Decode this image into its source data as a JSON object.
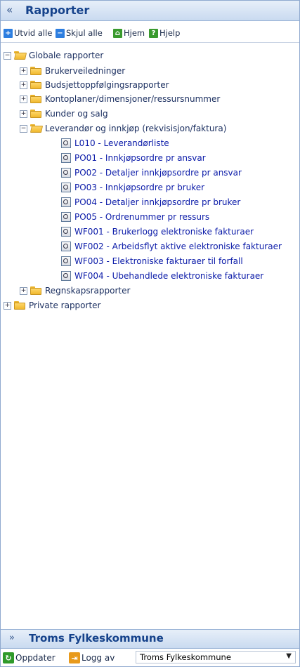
{
  "header": {
    "title": "Rapporter",
    "collapse_glyph": "«"
  },
  "toolbar": {
    "expand_all": "Utvid alle",
    "collapse_all": "Skjul alle",
    "home": "Hjem",
    "help": "Hjelp"
  },
  "tree": {
    "global": "Globale rapporter",
    "folders": {
      "brukerveiledninger": "Brukerveiledninger",
      "budsjett": "Budsjettoppfølgingsrapporter",
      "kontoplaner": "Kontoplaner/dimensjoner/ressursnummer",
      "kunder": "Kunder og salg",
      "leverandor": "Leverandør og innkjøp (rekvisisjon/faktura)",
      "regnskap": "Regnskapsrapporter"
    },
    "reports": [
      "L010 - Leverandørliste",
      "PO01 - Innkjøpsordre pr ansvar",
      "PO02 - Detaljer innkjøpsordre pr ansvar",
      "PO03 - Innkjøpsordre pr bruker",
      "PO04 - Detaljer innkjøpsordre pr bruker",
      "PO05 - Ordrenummer pr ressurs",
      "WF001 - Brukerlogg elektroniske fakturaer",
      "WF002 - Arbeidsflyt aktive elektroniske fakturaer",
      "WF003 - Elektroniske fakturaer til forfall",
      "WF004 - Ubehandlede elektroniske fakturaer"
    ],
    "private": "Private rapporter",
    "expander_plus": "+",
    "expander_minus": "−"
  },
  "footer": {
    "title": "Troms Fylkeskommune",
    "expand_glyph": "»",
    "refresh": "Oppdater",
    "logout": "Logg av",
    "org_select": "Troms Fylkeskommune"
  },
  "colors": {
    "header_text": "#15428b",
    "report_link": "#0a1aa8"
  }
}
